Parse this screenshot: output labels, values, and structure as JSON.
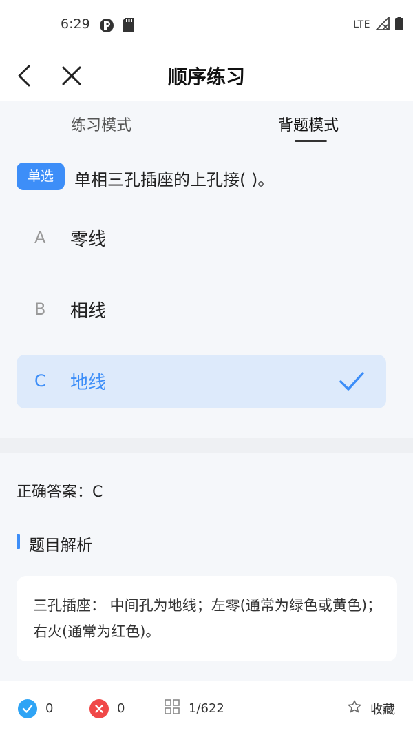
{
  "status": {
    "time": "6:29",
    "network": "LTE"
  },
  "nav": {
    "title": "顺序练习"
  },
  "tabs": [
    {
      "label": "练习模式",
      "active": false
    },
    {
      "label": "背题模式",
      "active": true
    }
  ],
  "question": {
    "type_badge": "单选",
    "text": "单相三孔插座的上孔接( )。",
    "options": [
      {
        "letter": "A",
        "text": "零线",
        "selected": false
      },
      {
        "letter": "B",
        "text": "相线",
        "selected": false
      },
      {
        "letter": "C",
        "text": "地线",
        "selected": true
      }
    ]
  },
  "answer": {
    "label": "正确答案：C"
  },
  "analysis": {
    "title": "题目解析",
    "text": "三孔插座： 中间孔为地线；左零(通常为绿色或黄色)；右火(通常为红色)。"
  },
  "bottom": {
    "correct_count": "0",
    "wrong_count": "0",
    "progress": "1/622",
    "favorite_label": "收藏"
  },
  "colors": {
    "accent": "#3d8ef8",
    "correct": "#2fa4f5",
    "wrong": "#f04848",
    "selected_bg": "#ddeafb"
  }
}
